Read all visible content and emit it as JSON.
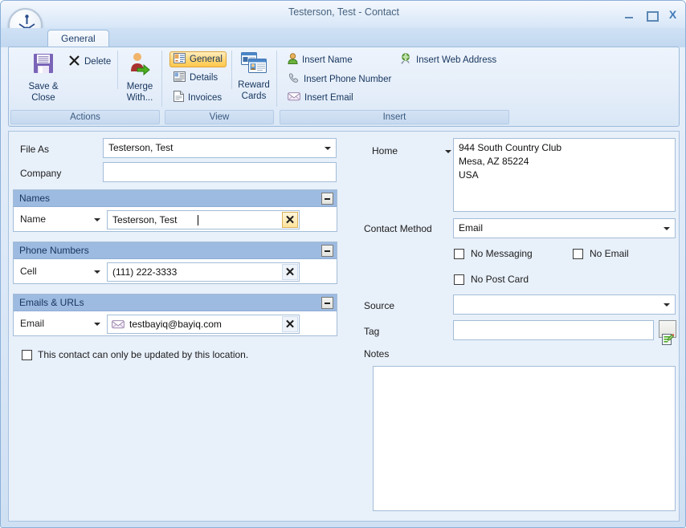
{
  "window": {
    "title": "Testerson, Test - Contact",
    "logo_icon": "compass-logo-icon",
    "minimize_label": "Minimize",
    "maximize_label": "Maximize",
    "close_label": "Close"
  },
  "tabs": [
    {
      "label": "General",
      "active": true
    }
  ],
  "ribbon": {
    "groups": [
      {
        "name": "Actions",
        "label": "Actions",
        "buttons": [
          {
            "label": "Save &\nClose",
            "label_line1": "Save &",
            "label_line2": "Close",
            "icon": "floppy-disk-icon"
          },
          {
            "label": "Delete",
            "icon": "x-mark-icon"
          },
          {
            "label_line1": "Merge",
            "label_line2": "With...",
            "label": "Merge With...",
            "icon": "merge-person-icon"
          }
        ]
      },
      {
        "name": "View",
        "label": "View",
        "buttons": [
          {
            "label": "General",
            "icon": "contact-card-icon",
            "selected": true
          },
          {
            "label": "Details",
            "icon": "details-card-icon",
            "selected": false
          },
          {
            "label": "Invoices",
            "icon": "document-icon",
            "selected": false
          },
          {
            "label_line1": "Reward",
            "label_line2": "Cards",
            "label": "Reward Cards",
            "icon": "reward-cards-icon"
          }
        ]
      },
      {
        "name": "Insert",
        "label": "Insert",
        "buttons": [
          {
            "label": "Insert Name",
            "icon": "person-icon"
          },
          {
            "label": "Insert Web Address",
            "icon": "globe-link-icon"
          },
          {
            "label": "Insert Phone Number",
            "icon": "phone-icon"
          },
          {
            "label": "Insert Email",
            "icon": "envelope-icon"
          }
        ]
      }
    ]
  },
  "form": {
    "file_as": {
      "label": "File As",
      "value": "Testerson, Test",
      "placeholder": ""
    },
    "company": {
      "label": "Company",
      "value": "",
      "placeholder": ""
    },
    "names_section": {
      "title": "Names",
      "collapse_icon": "minus-icon",
      "rows": [
        {
          "type": "Name",
          "value": "Testerson, Test",
          "clear_icon": "clear-x-icon",
          "focused": true
        }
      ]
    },
    "phones_section": {
      "title": "Phone Numbers",
      "collapse_icon": "minus-icon",
      "rows": [
        {
          "type": "Cell",
          "value": "(111) 222-3333",
          "clear_icon": "clear-x-icon",
          "focused": false
        }
      ]
    },
    "emails_section": {
      "title": "Emails & URLs",
      "collapse_icon": "minus-icon",
      "rows": [
        {
          "type": "Email",
          "value": "testbayiq@bayiq.com",
          "row_icon": "envelope-icon",
          "clear_icon": "clear-x-icon",
          "focused": false
        }
      ]
    },
    "location_lock": {
      "label": "This contact can only be updated by this location.",
      "checked": false
    },
    "address": {
      "type_label": "Home",
      "lines": [
        "944 South Country Club",
        "Mesa, AZ 85224",
        "USA"
      ],
      "value": "944 South Country Club\nMesa, AZ 85224\nUSA"
    },
    "contact_method": {
      "label": "Contact Method",
      "value": "Email"
    },
    "no_messaging": {
      "label": "No Messaging",
      "checked": false
    },
    "no_email": {
      "label": "No Email",
      "checked": false
    },
    "no_post_card": {
      "label": "No Post Card",
      "checked": false
    },
    "source": {
      "label": "Source",
      "value": "",
      "placeholder": ""
    },
    "tag": {
      "label": "Tag",
      "value": "",
      "placeholder": "",
      "button_icon": "edit-tag-icon"
    },
    "notes": {
      "label": "Notes",
      "value": "",
      "placeholder": ""
    }
  },
  "colors": {
    "section_header": "#9dbae0",
    "panel_bg": "#e8f0fa",
    "selected_button": "#ffd573",
    "field_border": "#a3bdd8",
    "title_text": "#46627f"
  }
}
